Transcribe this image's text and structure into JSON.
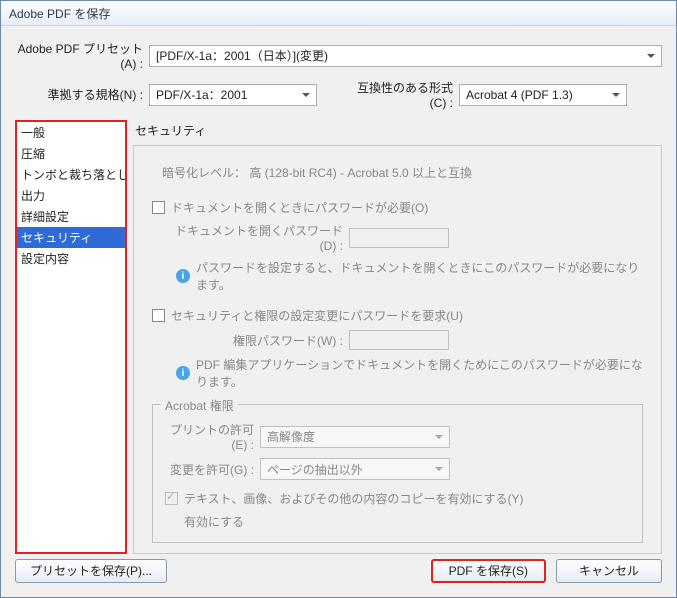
{
  "window": {
    "title": "Adobe PDF を保存"
  },
  "preset": {
    "label": "Adobe PDF プリセット(A) :",
    "value": "[PDF/X-1a：2001（日本）](変更)"
  },
  "standard": {
    "label": "準拠する規格(N) :",
    "value": "PDF/X-1a：2001"
  },
  "compat": {
    "label": "互換性のある形式(C) :",
    "value": "Acrobat 4 (PDF 1.3)"
  },
  "sidebar": {
    "items": [
      "一般",
      "圧縮",
      "トンボと裁ち落とし",
      "出力",
      "詳細設定",
      "セキュリティ",
      "設定内容"
    ],
    "selectedIndex": 5
  },
  "panel": {
    "heading": "セキュリティ",
    "encLevel": "暗号化レベル： 高 (128-bit RC4) - Acrobat 5.0 以上と互換",
    "openPw": {
      "check": "ドキュメントを開くときにパスワードが必要(O)",
      "label": "ドキュメントを開くパスワード(D) :",
      "info": "パスワードを設定すると、ドキュメントを開くときにこのパスワードが必要になります。"
    },
    "permPw": {
      "check": "セキュリティと権限の設定変更にパスワードを要求(U)",
      "label": "権限パスワード(W) :",
      "info": "PDF 編集アプリケーションでドキュメントを開くためにこのパスワードが必要になります。"
    },
    "acrobat": {
      "legend": "Acrobat 権限",
      "print": {
        "label": "プリントの許可(E) :",
        "value": "高解像度"
      },
      "changes": {
        "label": "変更を許可(G) :",
        "value": "ページの抽出以外"
      },
      "copy": {
        "check": "テキスト、画像、およびその他の内容のコピーを有効にする(Y)",
        "sub": "有効にする"
      }
    }
  },
  "footer": {
    "savePreset": "プリセットを保存(P)...",
    "savePdf": "PDF を保存(S)",
    "cancel": "キャンセル"
  }
}
